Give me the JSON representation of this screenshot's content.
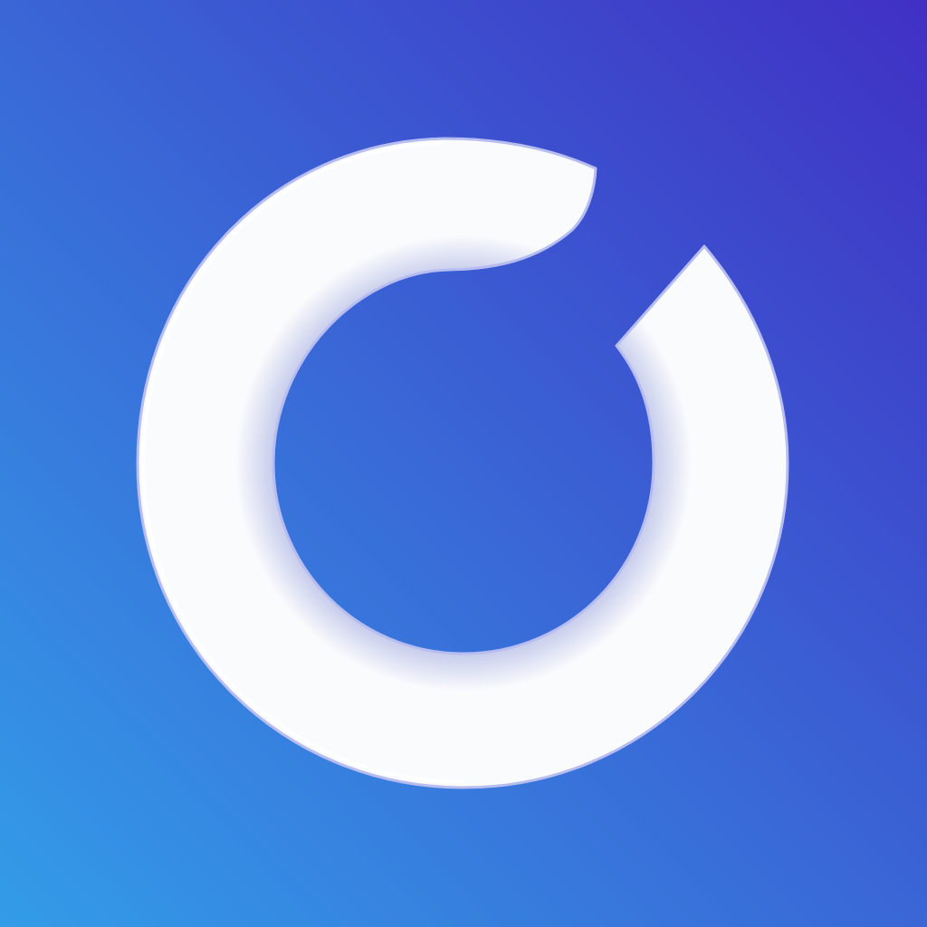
{
  "icon": {
    "symbol": "ring-logo-icon",
    "colors": {
      "gradient_start": "#339ce8",
      "gradient_end": "#4030c4",
      "ring_fill": "#fafbfd",
      "ring_inner_shade": "#c5cbeb",
      "ring_outline": "#b7bdf0"
    }
  }
}
